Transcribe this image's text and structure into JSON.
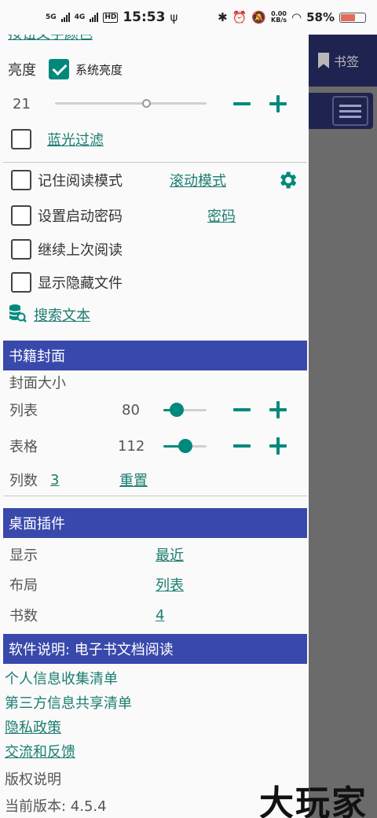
{
  "status_bar": {
    "sig1": "5G",
    "sig2": "4G",
    "hd": "HD",
    "time": "15:53",
    "net_speed_value": "0.00",
    "net_speed_unit": "KB/s",
    "battery": "58%"
  },
  "background": {
    "bookmark_label": "书签"
  },
  "drawer": {
    "top_cut_link": "按钮文字颜色",
    "brightness_label": "亮度",
    "system_brightness_label": "系统亮度",
    "system_brightness_checked": true,
    "brightness_value": "21",
    "brightness_level": 0.6,
    "blue_filter_label": "蓝光过滤",
    "remember_mode_label": "记住阅读模式",
    "scroll_mode_link": "滚动模式",
    "startup_password_label": "设置启动密码",
    "password_link": "密码",
    "continue_reading_label": "继续上次阅读",
    "show_hidden_label": "显示隐藏文件",
    "search_text_link": "搜索文本",
    "cover_section": {
      "title": "书籍封面",
      "cover_size_label": "封面大小",
      "list_label": "列表",
      "list_value": "80",
      "list_level": 0.3,
      "grid_label": "表格",
      "grid_value": "112",
      "grid_level": 0.5,
      "columns_label": "列数",
      "columns_value": "3",
      "reset_link": "重置"
    },
    "widget_section": {
      "title": "桌面插件",
      "display_label": "显示",
      "display_value": "最近",
      "layout_label": "布局",
      "layout_value": "列表",
      "count_label": "书数",
      "count_value": "4"
    },
    "about_section": {
      "title": "软件说明: 电子书文档阅读",
      "personal_info": "个人信息收集清单",
      "third_party": "第三方信息共享清单",
      "privacy": "隐私政策",
      "feedback": "交流和反馈",
      "copyright": "版权说明",
      "version": "当前版本: 4.5.4"
    }
  },
  "watermark": "大玩家"
}
